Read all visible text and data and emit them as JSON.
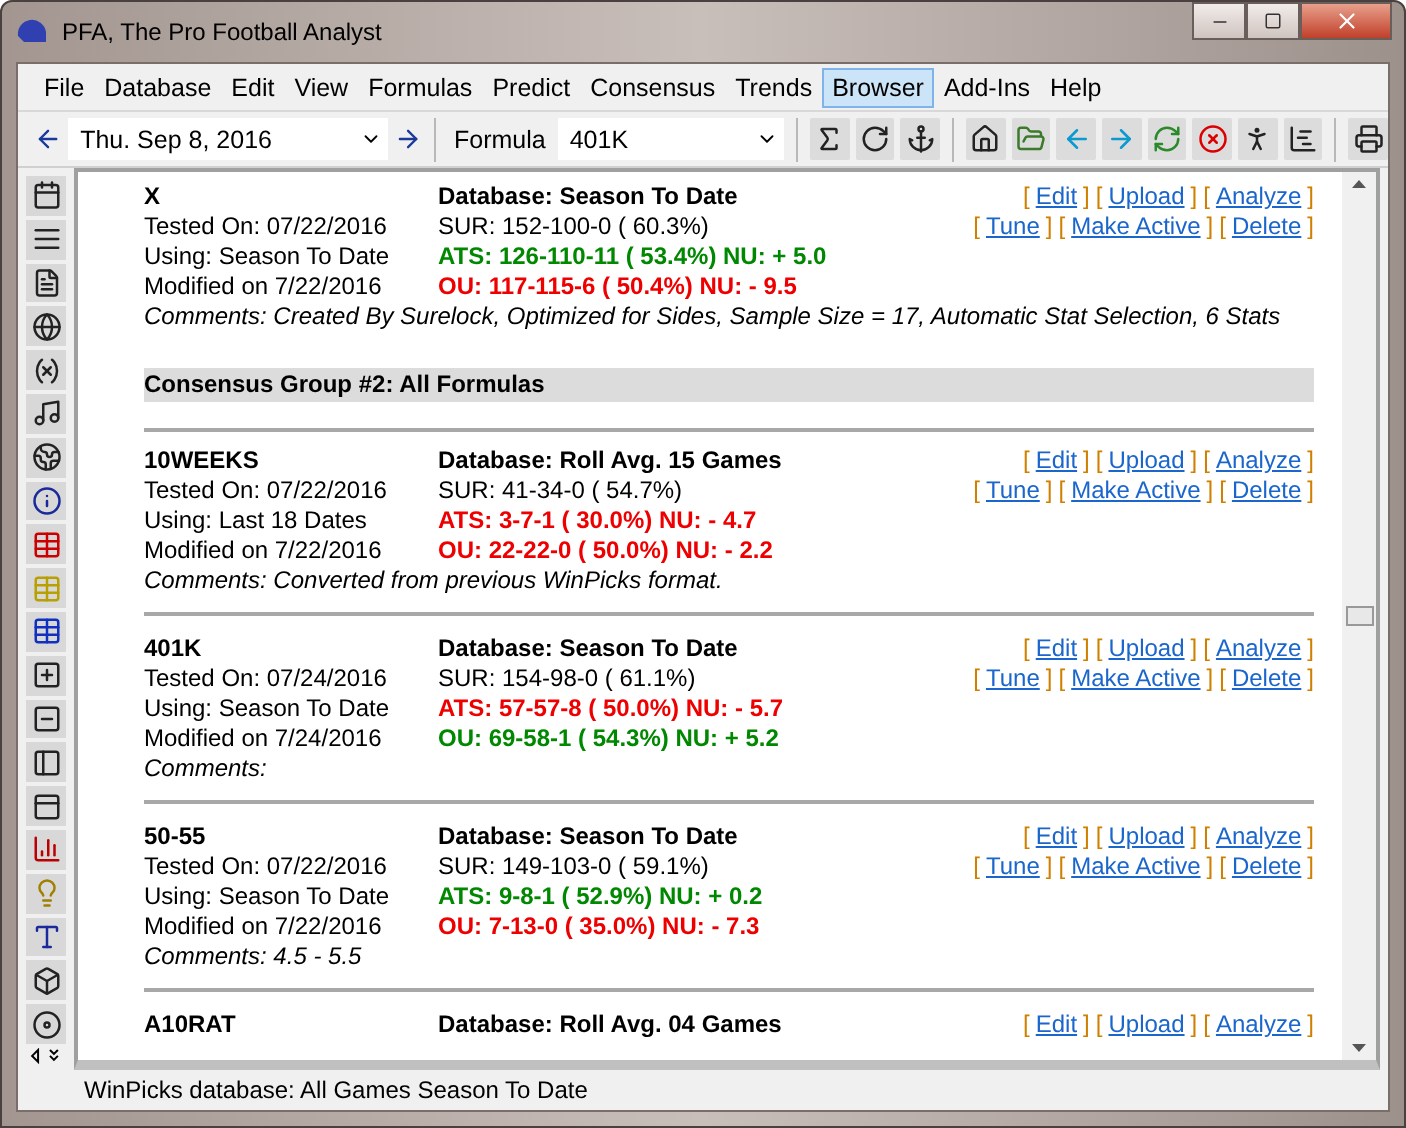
{
  "window": {
    "title": "PFA,  The Pro Football Analyst"
  },
  "menu": [
    {
      "label": "File",
      "selected": false
    },
    {
      "label": "Database",
      "selected": false
    },
    {
      "label": "Edit",
      "selected": false
    },
    {
      "label": "View",
      "selected": false
    },
    {
      "label": "Formulas",
      "selected": false
    },
    {
      "label": "Predict",
      "selected": false
    },
    {
      "label": "Consensus",
      "selected": false
    },
    {
      "label": "Trends",
      "selected": false
    },
    {
      "label": "Browser",
      "selected": true
    },
    {
      "label": "Add-Ins",
      "selected": false
    },
    {
      "label": "Help",
      "selected": false
    }
  ],
  "toolbar": {
    "date": "Thu. Sep  8, 2016",
    "formula_label": "Formula",
    "formula": "401K"
  },
  "records_before": [
    {
      "name": "X",
      "tested": "Tested On: 07/22/2016",
      "using": "Using: Season To Date",
      "modified": "Modified on 7/22/2016",
      "comments": "Comments: Created By Surelock, Optimized for Sides, Sample Size = 17, Automatic Stat Selection, 6 Stats",
      "database": "Database: Season To Date",
      "sur": "SUR: 152-100-0 ( 60.3%)",
      "ats": {
        "text": "ATS: 126-110-11 ( 53.4%) NU: + 5.0",
        "positive": true
      },
      "ou": {
        "text": "OU: 117-115-6 ( 50.4%) NU: - 9.5",
        "positive": false
      },
      "actions": [
        [
          {
            "open": "[",
            "label": "Edit",
            "close": "]"
          },
          {
            "open": "[",
            "label": "Upload",
            "close": "]"
          },
          {
            "open": "[",
            "label": "Analyze",
            "close": "]"
          }
        ],
        [
          {
            "open": "[",
            "label": "Tune",
            "close": "]"
          },
          {
            "open": "[",
            "label": "Make Active",
            "close": "]"
          },
          {
            "open": "[",
            "label": "Delete",
            "close": "]"
          }
        ]
      ]
    }
  ],
  "group_heading": "Consensus Group #2: All Formulas",
  "records": [
    {
      "name": "10WEEKS",
      "tested": "Tested On: 07/22/2016",
      "using": "Using: Last 18 Dates",
      "modified": "Modified on 7/22/2016",
      "comments": "Comments: Converted from previous WinPicks format.",
      "database": "Database: Roll Avg. 15 Games",
      "sur": "SUR: 41-34-0 ( 54.7%)",
      "ats": {
        "text": "ATS: 3-7-1 ( 30.0%) NU: - 4.7",
        "positive": false
      },
      "ou": {
        "text": "OU: 22-22-0 ( 50.0%) NU: - 2.2",
        "positive": false
      },
      "actions": [
        [
          {
            "open": "[",
            "label": "Edit",
            "close": "]"
          },
          {
            "open": "[",
            "label": "Upload",
            "close": "]"
          },
          {
            "open": "[",
            "label": "Analyze",
            "close": "]"
          }
        ],
        [
          {
            "open": "[",
            "label": "Tune",
            "close": "]"
          },
          {
            "open": "[",
            "label": "Make Active",
            "close": "]"
          },
          {
            "open": "[",
            "label": "Delete",
            "close": "]"
          }
        ]
      ]
    },
    {
      "name": "401K",
      "tested": "Tested On: 07/24/2016",
      "using": "Using: Season To Date",
      "modified": "Modified on 7/24/2016",
      "comments": "Comments:",
      "database": "Database: Season To Date",
      "sur": "SUR: 154-98-0 ( 61.1%)",
      "ats": {
        "text": "ATS: 57-57-8 ( 50.0%) NU: - 5.7",
        "positive": false
      },
      "ou": {
        "text": "OU: 69-58-1 ( 54.3%) NU: + 5.2",
        "positive": true
      },
      "actions": [
        [
          {
            "open": "[",
            "label": "Edit",
            "close": "]"
          },
          {
            "open": "[",
            "label": "Upload",
            "close": "]"
          },
          {
            "open": "[",
            "label": "Analyze",
            "close": "]"
          }
        ],
        [
          {
            "open": "[",
            "label": "Tune",
            "close": "]"
          },
          {
            "open": "[",
            "label": "Make Active",
            "close": "]"
          },
          {
            "open": "[",
            "label": "Delete",
            "close": "]"
          }
        ]
      ]
    },
    {
      "name": "50-55",
      "tested": "Tested On: 07/22/2016",
      "using": "Using: Season To Date",
      "modified": "Modified on 7/22/2016",
      "comments": "Comments: 4.5 - 5.5",
      "database": "Database: Season To Date",
      "sur": "SUR: 149-103-0 ( 59.1%)",
      "ats": {
        "text": "ATS: 9-8-1 ( 52.9%) NU: + 0.2",
        "positive": true
      },
      "ou": {
        "text": "OU: 7-13-0 ( 35.0%) NU: - 7.3",
        "positive": false
      },
      "actions": [
        [
          {
            "open": "[",
            "label": "Edit",
            "close": "]"
          },
          {
            "open": "[",
            "label": "Upload",
            "close": "]"
          },
          {
            "open": "[",
            "label": "Analyze",
            "close": "]"
          }
        ],
        [
          {
            "open": "[",
            "label": "Tune",
            "close": "]"
          },
          {
            "open": "[",
            "label": "Make Active",
            "close": "]"
          },
          {
            "open": "[",
            "label": "Delete",
            "close": "]"
          }
        ]
      ]
    },
    {
      "name": "A10RAT",
      "database": "Database: Roll Avg. 04 Games",
      "actions": [
        [
          {
            "open": "[",
            "label": "Edit",
            "close": "]"
          },
          {
            "open": "[",
            "label": "Upload",
            "close": "]"
          },
          {
            "open": "[",
            "label": "Analyze",
            "close": "]"
          }
        ]
      ]
    }
  ],
  "status_bar": "WinPicks database:  All Games Season To Date"
}
